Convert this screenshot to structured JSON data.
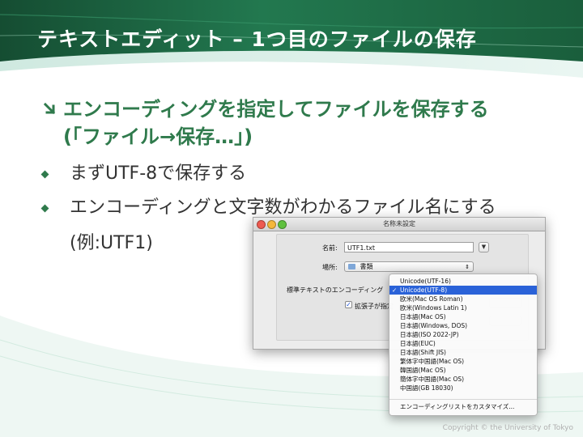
{
  "slide": {
    "title": "テキストエディット – 1つ目のファイルの保存",
    "main_bullet": "エンコーディングを指定してファイルを保存する",
    "main_bullet_line2": "(「ファイル→保存…」)",
    "sub_bullets": [
      "まずUTF-8で保存する",
      "エンコーディングと文字数がわかるファイル名にする"
    ],
    "sub_bullet_cont": "(例:UTF1)",
    "footer": "Copyright © the University of Tokyo"
  },
  "dialog": {
    "window_title": "名称未設定",
    "name_label": "名前:",
    "name_value": "UTF1.txt",
    "where_label": "場所:",
    "where_value": "書類",
    "encoding_label": "標準テキストのエンコーディング",
    "extension_checkbox_label": "拡張子が指定",
    "extension_checked": true
  },
  "encoding_menu": {
    "selected_index": 1,
    "items": [
      "Unicode(UTF-16)",
      "Unicode(UTF-8)",
      "欧米(Mac OS Roman)",
      "欧米(Windows Latin 1)",
      "日本語(Mac OS)",
      "日本語(Windows, DOS)",
      "日本語(ISO 2022-JP)",
      "日本語(EUC)",
      "日本語(Shift JIS)",
      "繁体字中国語(Mac OS)",
      "韓国語(Mac OS)",
      "簡体字中国語(Mac OS)",
      "中国語(GB 18030)"
    ],
    "customize": "エンコーディングリストをカスタマイズ..."
  },
  "colors": {
    "title_band": "#1f6b47",
    "accent_green": "#2f7a4c",
    "selection_blue": "#2a62d8"
  }
}
